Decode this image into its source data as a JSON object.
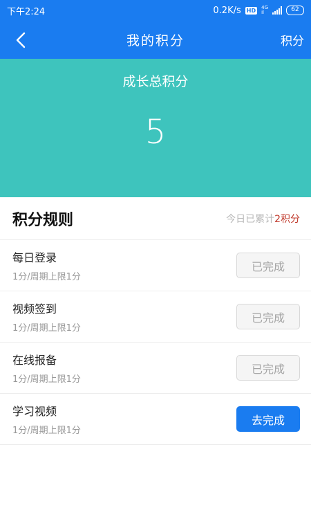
{
  "status_bar": {
    "time": "下午2:24",
    "network_speed": "0.2K/s",
    "hd_badge": "HD",
    "network_type_top": "4G",
    "network_type_bottom": "il",
    "battery": "62"
  },
  "nav": {
    "back_icon": "chevron-left-icon",
    "title": "我的积分",
    "right_label": "积分"
  },
  "hero": {
    "label": "成长总积分",
    "value": "5"
  },
  "rules": {
    "title": "积分规则",
    "summary_prefix": "今日已累计",
    "summary_value": "2积分"
  },
  "tasks": [
    {
      "name": "每日登录",
      "desc": "1分/周期上限1分",
      "button": "已完成",
      "status": "done"
    },
    {
      "name": "视频签到",
      "desc": "1分/周期上限1分",
      "button": "已完成",
      "status": "done"
    },
    {
      "name": "在线报备",
      "desc": "1分/周期上限1分",
      "button": "已完成",
      "status": "done"
    },
    {
      "name": "学习视频",
      "desc": "1分/周期上限1分",
      "button": "去完成",
      "status": "todo"
    }
  ],
  "colors": {
    "primary": "#1a7cf0",
    "hero": "#3ec4bd",
    "accent": "#c0392b"
  }
}
